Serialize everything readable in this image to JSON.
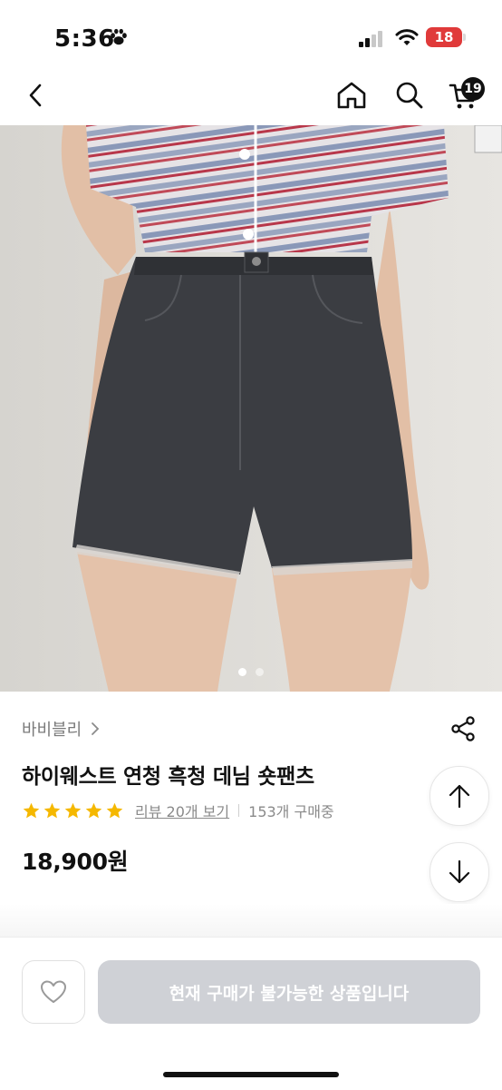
{
  "status_bar": {
    "time": "5:36",
    "battery": "18"
  },
  "header": {
    "cart_count": "19"
  },
  "product": {
    "brand": "바비블리",
    "title": "하이웨스트 연청 흑청 데님 숏팬츠",
    "rating_stars": 5,
    "review_link": "리뷰 20개 보기",
    "purchase_count": "153개 구매중",
    "price": "18,900원"
  },
  "gallery": {
    "current_image": 1,
    "total_images": 2
  },
  "bottom_bar": {
    "buy_button_label": "현재 구매가 불가능한 상품입니다"
  },
  "colors": {
    "star": "#f5b800",
    "disabled_button": "#cfd1d6",
    "battery": "#e03a3a"
  }
}
